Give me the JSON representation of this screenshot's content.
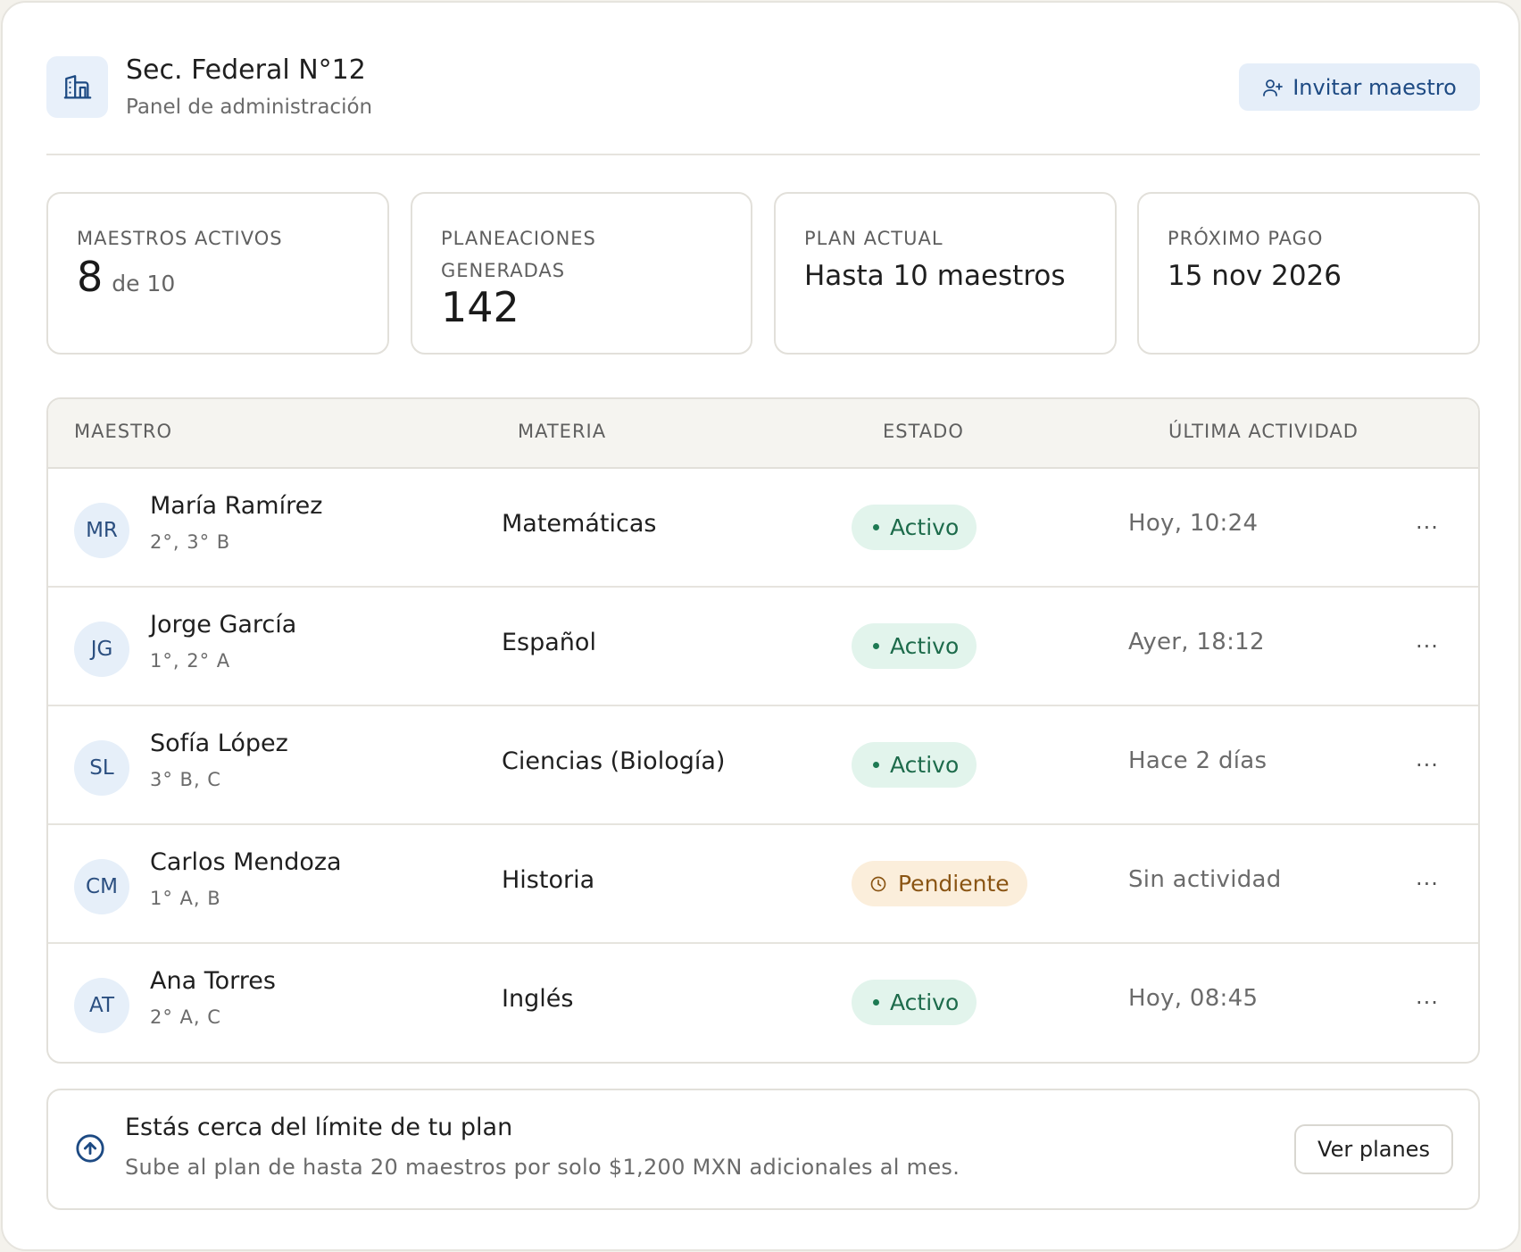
{
  "header": {
    "school_name": "Sec. Federal N°12",
    "subtitle": "Panel de administración",
    "invite_label": "Invitar maestro"
  },
  "stats": {
    "active_teachers": {
      "label": "MAESTROS ACTIVOS",
      "value": "8",
      "suffix": "de 10"
    },
    "plans_generated": {
      "label": "PLANEACIONES GENERADAS",
      "value": "142"
    },
    "current_plan": {
      "label": "PLAN ACTUAL",
      "value": "Hasta 10 maestros"
    },
    "next_payment": {
      "label": "PRÓXIMO PAGO",
      "value": "15 nov 2026"
    }
  },
  "table": {
    "headers": {
      "teacher": "MAESTRO",
      "subject": "MATERIA",
      "status": "ESTADO",
      "last_activity": "ÚLTIMA ACTIVIDAD"
    },
    "rows": [
      {
        "initials": "MR",
        "name": "María Ramírez",
        "groups": "2°, 3° B",
        "subject": "Matemáticas",
        "status": "Activo",
        "status_type": "active",
        "activity": "Hoy, 10:24"
      },
      {
        "initials": "JG",
        "name": "Jorge García",
        "groups": "1°, 2° A",
        "subject": "Español",
        "status": "Activo",
        "status_type": "active",
        "activity": "Ayer, 18:12"
      },
      {
        "initials": "SL",
        "name": "Sofía López",
        "groups": "3° B, C",
        "subject": "Ciencias (Biología)",
        "status": "Activo",
        "status_type": "active",
        "activity": "Hace 2 días"
      },
      {
        "initials": "CM",
        "name": "Carlos Mendoza",
        "groups": "1° A, B",
        "subject": "Historia",
        "status": "Pendiente",
        "status_type": "pending",
        "activity": "Sin actividad"
      },
      {
        "initials": "AT",
        "name": "Ana Torres",
        "groups": "2° A, C",
        "subject": "Inglés",
        "status": "Activo",
        "status_type": "active",
        "activity": "Hoy, 08:45"
      }
    ],
    "more_label": "···"
  },
  "banner": {
    "title": "Estás cerca del límite de tu plan",
    "text": "Sube al plan de hasta 20 maestros por solo $1,200 MXN adicionales al mes.",
    "button_label": "Ver planes"
  },
  "colors": {
    "accent": "#1d4a83",
    "active_bg": "#e2f4ec",
    "active_fg": "#1d6b4b",
    "pending_bg": "#fbeedb",
    "pending_fg": "#8a5514"
  }
}
